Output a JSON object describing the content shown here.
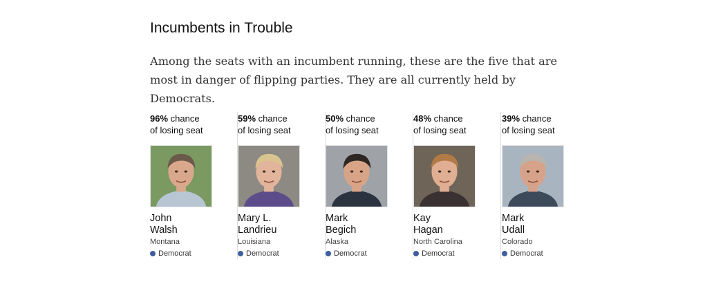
{
  "title": "Incumbents in Trouble",
  "dek": "Among the seats with an incumbent running, these are the five that are most in danger of flipping parties. They are all currently held by Democrats.",
  "chance_suffix": " chance",
  "chance_line2": "of losing seat",
  "party_color": "#3f5e9d",
  "candidates": [
    {
      "pct": "96%",
      "first": "John",
      "last": "Walsh",
      "state": "Montana",
      "party": "Democrat",
      "photo_bg": "#7a9a62",
      "skin": "#d9a88c",
      "hair": "#6b5a4a",
      "shirt": "#b8c6d4",
      "fidelity": 0.96
    },
    {
      "pct": "59%",
      "first": "Mary L.",
      "last": "Landrieu",
      "state": "Louisiana",
      "party": "Democrat",
      "photo_bg": "#8d8a84",
      "skin": "#e2b49b",
      "hair": "#d9c48f",
      "shirt": "#5c4d8a",
      "fidelity": 0.59
    },
    {
      "pct": "50%",
      "first": "Mark",
      "last": "Begich",
      "state": "Alaska",
      "party": "Democrat",
      "photo_bg": "#9fa3a8",
      "skin": "#d8a487",
      "hair": "#2e2622",
      "shirt": "#2b3240",
      "fidelity": 0.5
    },
    {
      "pct": "48%",
      "first": "Kay",
      "last": "Hagan",
      "state": "North Carolina",
      "party": "Democrat",
      "photo_bg": "#6e6458",
      "skin": "#e0ae92",
      "hair": "#b27a45",
      "shirt": "#3a3232",
      "fidelity": 0.48
    },
    {
      "pct": "39%",
      "first": "Mark",
      "last": "Udall",
      "state": "Colorado",
      "party": "Democrat",
      "photo_bg": "#a8b4bf",
      "skin": "#d6a38a",
      "hair": "#b8b4ae",
      "shirt": "#3d4a5a",
      "fidelity": 0.39
    }
  ]
}
